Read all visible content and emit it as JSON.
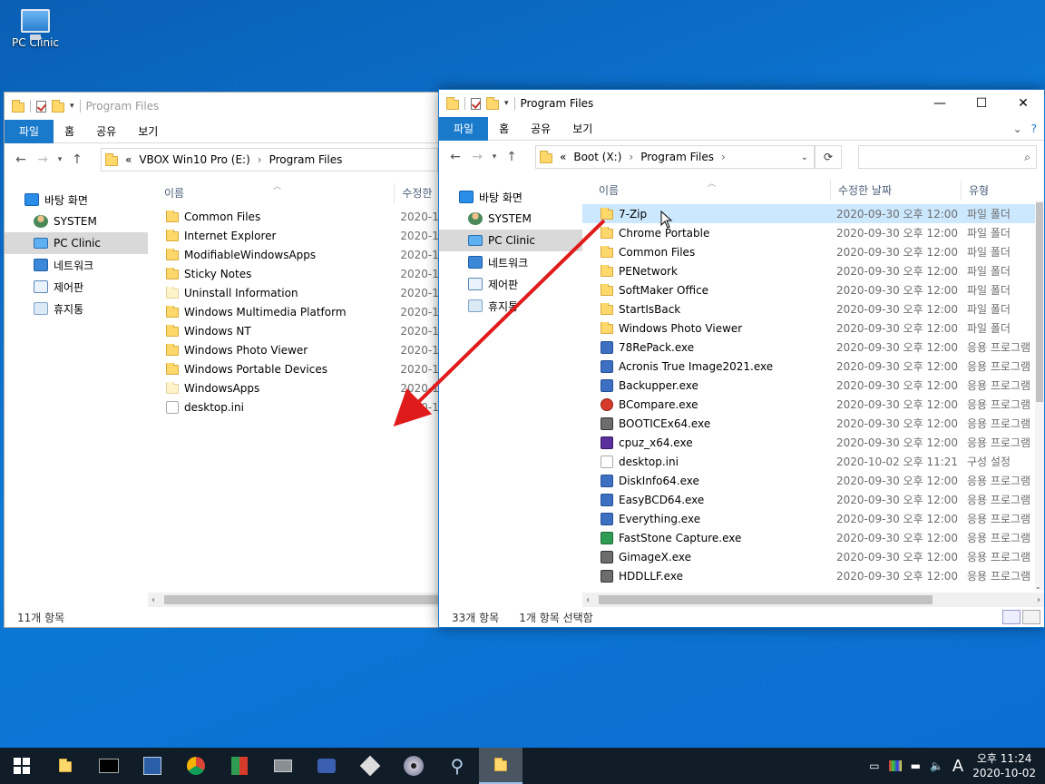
{
  "desktop": {
    "icon_label": "PC Clinic"
  },
  "left_window": {
    "title": "Program Files",
    "ribbon_tabs": [
      "파일",
      "홈",
      "공유",
      "보기"
    ],
    "address": {
      "prefix": "«",
      "crumbs": [
        "VBOX Win10 Pro (E:)",
        "Program Files"
      ]
    },
    "nav": [
      "바탕 화면",
      "SYSTEM",
      "PC Clinic",
      "네트워크",
      "제어판",
      "휴지통"
    ],
    "columns": {
      "name": "이름",
      "date": "수정한"
    },
    "rows": [
      {
        "name": "Common Files",
        "date": "2020-1",
        "icon": "folder"
      },
      {
        "name": "Internet Explorer",
        "date": "2020-1",
        "icon": "folder"
      },
      {
        "name": "ModifiableWindowsApps",
        "date": "2020-1",
        "icon": "folder"
      },
      {
        "name": "Sticky Notes",
        "date": "2020-1",
        "icon": "folder"
      },
      {
        "name": "Uninstall Information",
        "date": "2020-1",
        "icon": "folder-pale"
      },
      {
        "name": "Windows Multimedia Platform",
        "date": "2020-1",
        "icon": "folder"
      },
      {
        "name": "Windows NT",
        "date": "2020-1",
        "icon": "folder"
      },
      {
        "name": "Windows Photo Viewer",
        "date": "2020-1",
        "icon": "folder"
      },
      {
        "name": "Windows Portable Devices",
        "date": "2020-1",
        "icon": "folder"
      },
      {
        "name": "WindowsApps",
        "date": "2020-1",
        "icon": "folder-pale"
      },
      {
        "name": "desktop.ini",
        "date": "2020-1",
        "icon": "ini"
      }
    ],
    "status": "11개 항목"
  },
  "right_window": {
    "title": "Program Files",
    "ribbon_tabs": [
      "파일",
      "홈",
      "공유",
      "보기"
    ],
    "address": {
      "prefix": "«",
      "crumbs": [
        "Boot (X:)",
        "Program Files"
      ]
    },
    "nav": [
      "바탕 화면",
      "SYSTEM",
      "PC Clinic",
      "네트워크",
      "제어판",
      "휴지통"
    ],
    "columns": {
      "name": "이름",
      "date": "수정한 날짜",
      "type": "유형"
    },
    "rows": [
      {
        "name": "7-Zip",
        "date": "2020-09-30 오후 12:00",
        "type": "파일 폴더",
        "icon": "folder",
        "selected": true
      },
      {
        "name": "Chrome Portable",
        "date": "2020-09-30 오후 12:00",
        "type": "파일 폴더",
        "icon": "folder"
      },
      {
        "name": "Common Files",
        "date": "2020-09-30 오후 12:00",
        "type": "파일 폴더",
        "icon": "folder"
      },
      {
        "name": "PENetwork",
        "date": "2020-09-30 오후 12:00",
        "type": "파일 폴더",
        "icon": "folder"
      },
      {
        "name": "SoftMaker Office",
        "date": "2020-09-30 오후 12:00",
        "type": "파일 폴더",
        "icon": "folder"
      },
      {
        "name": "StartIsBack",
        "date": "2020-09-30 오후 12:00",
        "type": "파일 폴더",
        "icon": "folder"
      },
      {
        "name": "Windows Photo Viewer",
        "date": "2020-09-30 오후 12:00",
        "type": "파일 폴더",
        "icon": "folder"
      },
      {
        "name": "78RePack.exe",
        "date": "2020-09-30 오후 12:00",
        "type": "응용 프로그램",
        "icon": "exe"
      },
      {
        "name": "Acronis True Image2021.exe",
        "date": "2020-09-30 오후 12:00",
        "type": "응용 프로그램",
        "icon": "exe"
      },
      {
        "name": "Backupper.exe",
        "date": "2020-09-30 오후 12:00",
        "type": "응용 프로그램",
        "icon": "exe"
      },
      {
        "name": "BCompare.exe",
        "date": "2020-09-30 오후 12:00",
        "type": "응용 프로그램",
        "icon": "exe2"
      },
      {
        "name": "BOOTICEx64.exe",
        "date": "2020-09-30 오후 12:00",
        "type": "응용 프로그램",
        "icon": "exe4"
      },
      {
        "name": "cpuz_x64.exe",
        "date": "2020-09-30 오후 12:00",
        "type": "응용 프로그램",
        "icon": "exe3"
      },
      {
        "name": "desktop.ini",
        "date": "2020-10-02 오후 11:21",
        "type": "구성 설정",
        "icon": "ini"
      },
      {
        "name": "DiskInfo64.exe",
        "date": "2020-09-30 오후 12:00",
        "type": "응용 프로그램",
        "icon": "exe"
      },
      {
        "name": "EasyBCD64.exe",
        "date": "2020-09-30 오후 12:00",
        "type": "응용 프로그램",
        "icon": "exe"
      },
      {
        "name": "Everything.exe",
        "date": "2020-09-30 오후 12:00",
        "type": "응용 프로그램",
        "icon": "exe"
      },
      {
        "name": "FastStone Capture.exe",
        "date": "2020-09-30 오후 12:00",
        "type": "응용 프로그램",
        "icon": "exe5"
      },
      {
        "name": "GimageX.exe",
        "date": "2020-09-30 오후 12:00",
        "type": "응용 프로그램",
        "icon": "exe4"
      },
      {
        "name": "HDDLLF.exe",
        "date": "2020-09-30 오후 12:00",
        "type": "응용 프로그램",
        "icon": "exe4"
      }
    ],
    "status_count": "33개 항목",
    "status_selected": "1개 항목 선택함"
  },
  "taskbar": {
    "apps": [
      "start-icon",
      "file-explorer-icon",
      "cmd-icon",
      "save-icon",
      "chrome-icon",
      "app-icon",
      "app-icon",
      "app-icon",
      "app-icon",
      "disc-icon",
      "search-icon",
      "folder-icon"
    ],
    "ime": "A",
    "time": "오후 11:24",
    "date": "2020-10-02"
  }
}
